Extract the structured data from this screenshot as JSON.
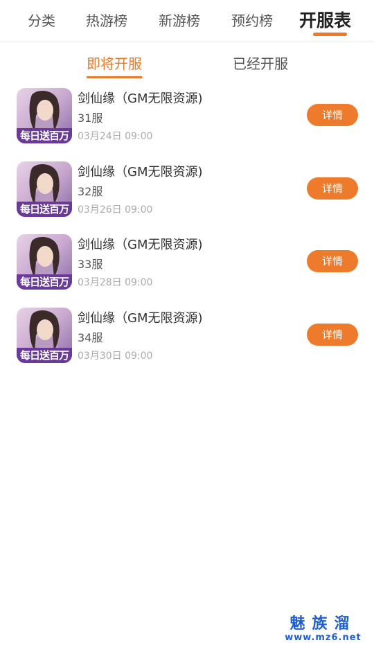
{
  "top_nav": {
    "tabs": [
      {
        "label": "分类"
      },
      {
        "label": "热游榜"
      },
      {
        "label": "新游榜"
      },
      {
        "label": "预约榜"
      },
      {
        "label": "开服表"
      }
    ],
    "active": "开服表"
  },
  "sub_tabs": {
    "tabs": [
      {
        "label": "即将开服"
      },
      {
        "label": "已经开服"
      }
    ],
    "active": "即将开服"
  },
  "servers": [
    {
      "name": "剑仙缘（GM无限资源)",
      "server": "31服",
      "time": "03月24日 09:00",
      "button": "详情",
      "banner": "每日送百万"
    },
    {
      "name": "剑仙缘（GM无限资源)",
      "server": "32服",
      "time": "03月26日 09:00",
      "button": "详情",
      "banner": "每日送百万"
    },
    {
      "name": "剑仙缘（GM无限资源)",
      "server": "33服",
      "time": "03月28日 09:00",
      "button": "详情",
      "banner": "每日送百万"
    },
    {
      "name": "剑仙缘（GM无限资源)",
      "server": "34服",
      "time": "03月30日 09:00",
      "button": "详情",
      "banner": "每日送百万"
    }
  ],
  "colors": {
    "accent": "#ee7a2b",
    "watermark": "#1f5fd6"
  },
  "watermark": {
    "logo": "魅族溜",
    "url": "www.mz6.net"
  }
}
